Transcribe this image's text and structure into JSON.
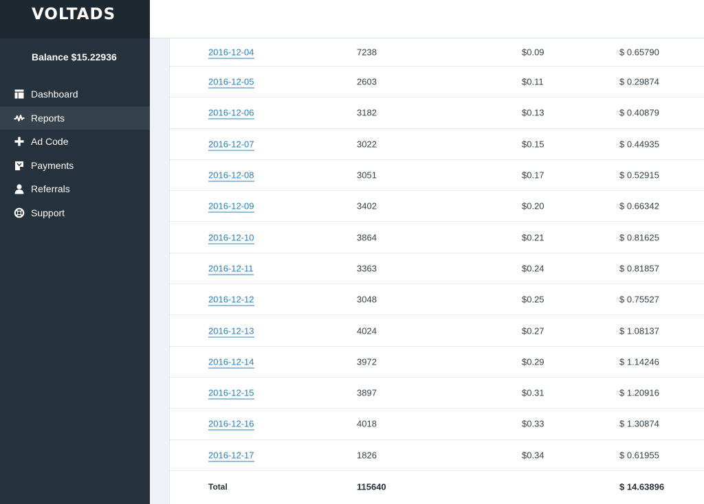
{
  "brand": {
    "logo": "VOLTADS"
  },
  "sidebar": {
    "balance": "Balance $15.22936",
    "items": [
      {
        "label": "Dashboard",
        "icon": "dashboard-icon",
        "active": false
      },
      {
        "label": "Reports",
        "icon": "reports-icon",
        "active": true
      },
      {
        "label": "Ad Code",
        "icon": "plus-icon",
        "active": false
      },
      {
        "label": "Payments",
        "icon": "payments-icon",
        "active": false
      },
      {
        "label": "Referrals",
        "icon": "user-icon",
        "active": false
      },
      {
        "label": "Support",
        "icon": "lifebuoy-icon",
        "active": false
      }
    ]
  },
  "report": {
    "rows": [
      {
        "date": "2016-12-04",
        "impressions": "7238",
        "cpm": "$0.09",
        "earnings": "$ 0.65790"
      },
      {
        "date": "2016-12-05",
        "impressions": "2603",
        "cpm": "$0.11",
        "earnings": "$ 0.29874"
      },
      {
        "date": "2016-12-06",
        "impressions": "3182",
        "cpm": "$0.13",
        "earnings": "$ 0.40879"
      },
      {
        "date": "2016-12-07",
        "impressions": "3022",
        "cpm": "$0.15",
        "earnings": "$ 0.44935"
      },
      {
        "date": "2016-12-08",
        "impressions": "3051",
        "cpm": "$0.17",
        "earnings": "$ 0.52915"
      },
      {
        "date": "2016-12-09",
        "impressions": "3402",
        "cpm": "$0.20",
        "earnings": "$ 0.66342"
      },
      {
        "date": "2016-12-10",
        "impressions": "3864",
        "cpm": "$0.21",
        "earnings": "$ 0.81625"
      },
      {
        "date": "2016-12-11",
        "impressions": "3363",
        "cpm": "$0.24",
        "earnings": "$ 0.81857"
      },
      {
        "date": "2016-12-12",
        "impressions": "3048",
        "cpm": "$0.25",
        "earnings": "$ 0.75527"
      },
      {
        "date": "2016-12-13",
        "impressions": "4024",
        "cpm": "$0.27",
        "earnings": "$ 1.08137"
      },
      {
        "date": "2016-12-14",
        "impressions": "3972",
        "cpm": "$0.29",
        "earnings": "$ 1.14246"
      },
      {
        "date": "2016-12-15",
        "impressions": "3897",
        "cpm": "$0.31",
        "earnings": "$ 1.20916"
      },
      {
        "date": "2016-12-16",
        "impressions": "4018",
        "cpm": "$0.33",
        "earnings": "$ 1.30874"
      },
      {
        "date": "2016-12-17",
        "impressions": "1826",
        "cpm": "$0.34",
        "earnings": "$ 0.61955"
      }
    ],
    "total": {
      "label": "Total",
      "impressions": "115640",
      "earnings": "$ 14.63896"
    }
  },
  "colors": {
    "sidebar": "#26323b",
    "logo_bar": "#1e2830",
    "active_item": "#34424c",
    "link": "#2b7fc0"
  }
}
